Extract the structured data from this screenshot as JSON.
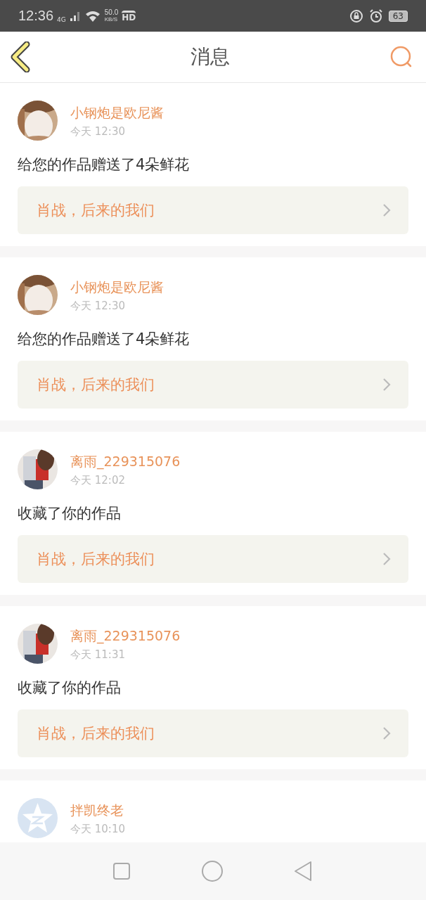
{
  "status_bar": {
    "time": "12:36",
    "network": "4G",
    "speed": "50.0",
    "speed_unit": "KB/S",
    "hd": "HD",
    "battery": "63"
  },
  "header": {
    "title": "消息"
  },
  "messages": [
    {
      "name": "小钢炮是欧尼酱",
      "time": "今天 12:30",
      "text": "给您的作品赠送了4朵鲜花",
      "work": "肖战，后来的我们"
    },
    {
      "name": "小钢炮是欧尼酱",
      "time": "今天 12:30",
      "text": "给您的作品赠送了4朵鲜花",
      "work": "肖战，后来的我们"
    },
    {
      "name": "离雨_229315076",
      "time": "今天 12:02",
      "text": "收藏了你的作品",
      "work": "肖战，后来的我们"
    },
    {
      "name": "离雨_229315076",
      "time": "今天 11:31",
      "text": "收藏了你的作品",
      "work": "肖战，后来的我们"
    },
    {
      "avatar": {
        "kind": "default"
      },
      "name": "拌凯终老",
      "time": "今天 10:10"
    }
  ]
}
